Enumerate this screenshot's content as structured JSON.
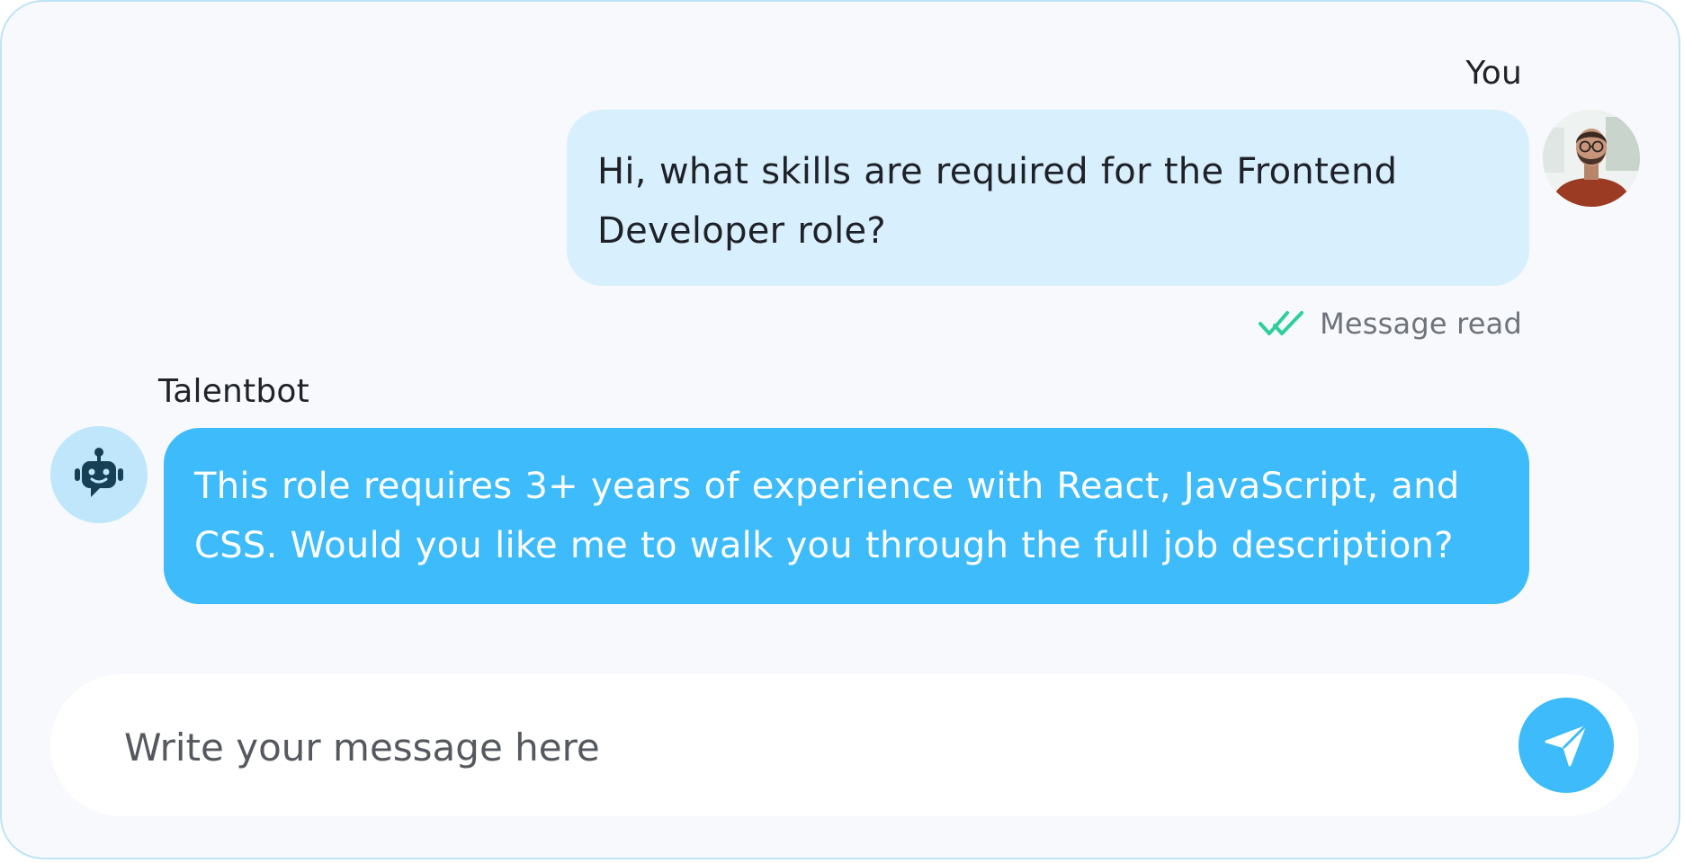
{
  "conversation": {
    "messages": [
      {
        "sender": "You",
        "text": "Hi, what skills are required for the Frontend Developer role?",
        "status_text": "Message read"
      },
      {
        "sender": "Talentbot",
        "text": "This role requires 3+ years of experience with React, JavaScript, and CSS. Would you like me to walk you through the full job description?"
      }
    ]
  },
  "composer": {
    "placeholder": "Write your message here"
  },
  "icons": {
    "user_avatar": "user-avatar-photo",
    "bot_avatar": "robot-icon",
    "read_receipt": "double-check-icon",
    "send": "send-icon"
  },
  "colors": {
    "card_background": "#f7f9fc",
    "card_border": "#bfe4f6",
    "user_bubble": "#d8effd",
    "bot_bubble": "#3dbbfb",
    "bot_avatar_background": "#bfe6fb",
    "send_button": "#3dbbfb",
    "read_check": "#2ecf9a"
  }
}
